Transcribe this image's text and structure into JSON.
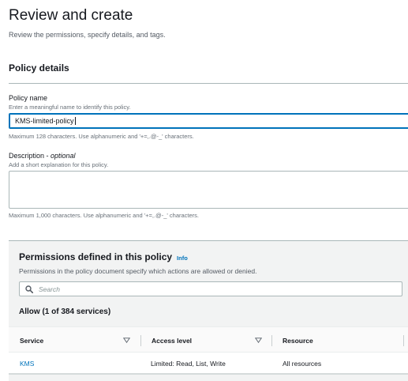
{
  "header": {
    "title": "Review and create",
    "subtitle": "Review the permissions, specify details, and tags."
  },
  "policy_details": {
    "section_title": "Policy details",
    "name": {
      "label": "Policy name",
      "hint": "Enter a meaningful name to identify this policy.",
      "value": "KMS-limited-policy",
      "constraint": "Maximum 128 characters. Use alphanumeric and '+=,.@-_' characters."
    },
    "description": {
      "label": "Description - ",
      "label_optional": "optional",
      "hint": "Add a short explanation for this policy.",
      "value": "",
      "constraint": "Maximum 1,000 characters. Use alphanumeric and '+=,.@-_' characters."
    }
  },
  "permissions": {
    "title": "Permissions defined in this policy",
    "info_label": "Info",
    "description": "Permissions in the policy document specify which actions are allowed or denied.",
    "search_placeholder": "Search",
    "allow_title": "Allow (1 of 384 services)",
    "columns": [
      "Service",
      "Access level",
      "Resource"
    ],
    "rows": [
      {
        "service": "KMS",
        "access_level": "Limited: Read, List, Write",
        "resource": "All resources"
      }
    ]
  },
  "colors": {
    "link": "#0073bb",
    "focus_border": "#0073bb",
    "panel_bg": "#f2f3f3"
  },
  "icons": [
    "search-icon",
    "sort-down-icon"
  ]
}
